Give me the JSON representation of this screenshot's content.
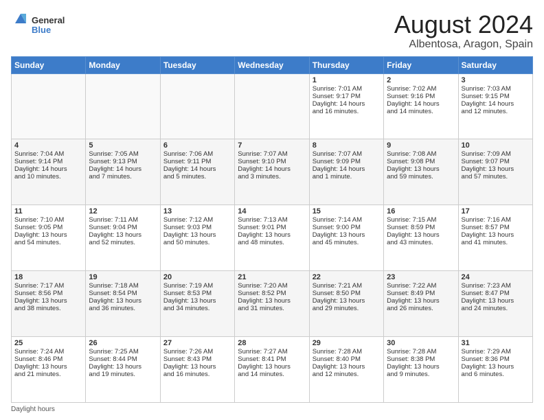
{
  "header": {
    "logo_general": "General",
    "logo_blue": "Blue",
    "main_title": "August 2024",
    "sub_title": "Albentosa, Aragon, Spain"
  },
  "calendar": {
    "days_of_week": [
      "Sunday",
      "Monday",
      "Tuesday",
      "Wednesday",
      "Thursday",
      "Friday",
      "Saturday"
    ],
    "weeks": [
      [
        {
          "day": "",
          "text": ""
        },
        {
          "day": "",
          "text": ""
        },
        {
          "day": "",
          "text": ""
        },
        {
          "day": "",
          "text": ""
        },
        {
          "day": "1",
          "text": "Sunrise: 7:01 AM\nSunset: 9:17 PM\nDaylight: 14 hours\nand 16 minutes."
        },
        {
          "day": "2",
          "text": "Sunrise: 7:02 AM\nSunset: 9:16 PM\nDaylight: 14 hours\nand 14 minutes."
        },
        {
          "day": "3",
          "text": "Sunrise: 7:03 AM\nSunset: 9:15 PM\nDaylight: 14 hours\nand 12 minutes."
        }
      ],
      [
        {
          "day": "4",
          "text": "Sunrise: 7:04 AM\nSunset: 9:14 PM\nDaylight: 14 hours\nand 10 minutes."
        },
        {
          "day": "5",
          "text": "Sunrise: 7:05 AM\nSunset: 9:13 PM\nDaylight: 14 hours\nand 7 minutes."
        },
        {
          "day": "6",
          "text": "Sunrise: 7:06 AM\nSunset: 9:11 PM\nDaylight: 14 hours\nand 5 minutes."
        },
        {
          "day": "7",
          "text": "Sunrise: 7:07 AM\nSunset: 9:10 PM\nDaylight: 14 hours\nand 3 minutes."
        },
        {
          "day": "8",
          "text": "Sunrise: 7:07 AM\nSunset: 9:09 PM\nDaylight: 14 hours\nand 1 minute."
        },
        {
          "day": "9",
          "text": "Sunrise: 7:08 AM\nSunset: 9:08 PM\nDaylight: 13 hours\nand 59 minutes."
        },
        {
          "day": "10",
          "text": "Sunrise: 7:09 AM\nSunset: 9:07 PM\nDaylight: 13 hours\nand 57 minutes."
        }
      ],
      [
        {
          "day": "11",
          "text": "Sunrise: 7:10 AM\nSunset: 9:05 PM\nDaylight: 13 hours\nand 54 minutes."
        },
        {
          "day": "12",
          "text": "Sunrise: 7:11 AM\nSunset: 9:04 PM\nDaylight: 13 hours\nand 52 minutes."
        },
        {
          "day": "13",
          "text": "Sunrise: 7:12 AM\nSunset: 9:03 PM\nDaylight: 13 hours\nand 50 minutes."
        },
        {
          "day": "14",
          "text": "Sunrise: 7:13 AM\nSunset: 9:01 PM\nDaylight: 13 hours\nand 48 minutes."
        },
        {
          "day": "15",
          "text": "Sunrise: 7:14 AM\nSunset: 9:00 PM\nDaylight: 13 hours\nand 45 minutes."
        },
        {
          "day": "16",
          "text": "Sunrise: 7:15 AM\nSunset: 8:59 PM\nDaylight: 13 hours\nand 43 minutes."
        },
        {
          "day": "17",
          "text": "Sunrise: 7:16 AM\nSunset: 8:57 PM\nDaylight: 13 hours\nand 41 minutes."
        }
      ],
      [
        {
          "day": "18",
          "text": "Sunrise: 7:17 AM\nSunset: 8:56 PM\nDaylight: 13 hours\nand 38 minutes."
        },
        {
          "day": "19",
          "text": "Sunrise: 7:18 AM\nSunset: 8:54 PM\nDaylight: 13 hours\nand 36 minutes."
        },
        {
          "day": "20",
          "text": "Sunrise: 7:19 AM\nSunset: 8:53 PM\nDaylight: 13 hours\nand 34 minutes."
        },
        {
          "day": "21",
          "text": "Sunrise: 7:20 AM\nSunset: 8:52 PM\nDaylight: 13 hours\nand 31 minutes."
        },
        {
          "day": "22",
          "text": "Sunrise: 7:21 AM\nSunset: 8:50 PM\nDaylight: 13 hours\nand 29 minutes."
        },
        {
          "day": "23",
          "text": "Sunrise: 7:22 AM\nSunset: 8:49 PM\nDaylight: 13 hours\nand 26 minutes."
        },
        {
          "day": "24",
          "text": "Sunrise: 7:23 AM\nSunset: 8:47 PM\nDaylight: 13 hours\nand 24 minutes."
        }
      ],
      [
        {
          "day": "25",
          "text": "Sunrise: 7:24 AM\nSunset: 8:46 PM\nDaylight: 13 hours\nand 21 minutes."
        },
        {
          "day": "26",
          "text": "Sunrise: 7:25 AM\nSunset: 8:44 PM\nDaylight: 13 hours\nand 19 minutes."
        },
        {
          "day": "27",
          "text": "Sunrise: 7:26 AM\nSunset: 8:43 PM\nDaylight: 13 hours\nand 16 minutes."
        },
        {
          "day": "28",
          "text": "Sunrise: 7:27 AM\nSunset: 8:41 PM\nDaylight: 13 hours\nand 14 minutes."
        },
        {
          "day": "29",
          "text": "Sunrise: 7:28 AM\nSunset: 8:40 PM\nDaylight: 13 hours\nand 12 minutes."
        },
        {
          "day": "30",
          "text": "Sunrise: 7:28 AM\nSunset: 8:38 PM\nDaylight: 13 hours\nand 9 minutes."
        },
        {
          "day": "31",
          "text": "Sunrise: 7:29 AM\nSunset: 8:36 PM\nDaylight: 13 hours\nand 6 minutes."
        }
      ]
    ]
  },
  "footer": {
    "label": "Daylight hours"
  }
}
